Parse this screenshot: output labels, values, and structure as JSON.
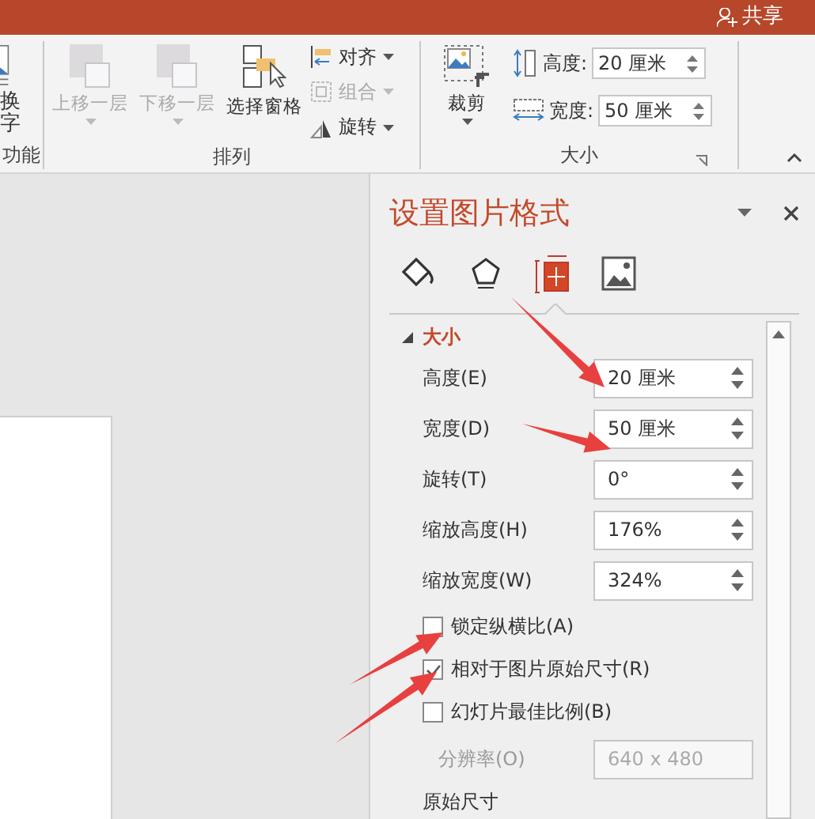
{
  "title_bar": {
    "share": "共享"
  },
  "ribbon": {
    "groups": [
      {
        "label": "功能",
        "items": [
          {
            "kind": "change_picture",
            "lines": [
              "换",
              "字"
            ]
          }
        ]
      },
      {
        "label": "排列",
        "items": [
          {
            "kind": "bring_forward",
            "label": "上移一层",
            "disabled": true
          },
          {
            "kind": "send_backward",
            "label": "下移一层",
            "disabled": true
          },
          {
            "kind": "selection_pane",
            "label": "选择窗格",
            "disabled": false
          },
          {
            "kind": "small_stack",
            "items": [
              {
                "kind": "align",
                "label": "对齐",
                "disabled": false
              },
              {
                "kind": "group",
                "label": "组合",
                "disabled": true
              },
              {
                "kind": "rotate",
                "label": "旋转",
                "disabled": false
              }
            ]
          }
        ]
      },
      {
        "label": "大小",
        "items": [
          {
            "kind": "crop",
            "label": "裁剪",
            "disabled": false
          },
          {
            "kind": "size_fields",
            "items": [
              {
                "kind": "height",
                "label": "高度:",
                "value": "20 厘米"
              },
              {
                "kind": "width",
                "label": "宽度:",
                "value": "50 厘米"
              }
            ]
          }
        ]
      }
    ]
  },
  "pane": {
    "title": "设置图片格式",
    "tabs": [
      {
        "kind": "fill",
        "selected": false
      },
      {
        "kind": "effects",
        "selected": false
      },
      {
        "kind": "size",
        "selected": true
      },
      {
        "kind": "picture",
        "selected": false
      }
    ],
    "section": {
      "title": "大小",
      "expanded": true
    },
    "rows": [
      {
        "kind": "spin",
        "label": "高度(E)",
        "value": "20 厘米"
      },
      {
        "kind": "spin",
        "label": "宽度(D)",
        "value": "50 厘米"
      },
      {
        "kind": "spin",
        "label": "旋转(T)",
        "value": "0°"
      },
      {
        "kind": "spin",
        "label": "缩放高度(H)",
        "value": "176%"
      },
      {
        "kind": "spin",
        "label": "缩放宽度(W)",
        "value": "324%"
      },
      {
        "kind": "check",
        "label": "锁定纵横比(A)",
        "checked": false
      },
      {
        "kind": "check",
        "label": "相对于图片原始尺寸(R)",
        "checked": true
      },
      {
        "kind": "check",
        "label": "幻灯片最佳比例(B)",
        "checked": false
      },
      {
        "kind": "select",
        "label": "分辨率(O)",
        "value": "640 x 480",
        "disabled": true
      },
      {
        "kind": "heading",
        "label": "原始尺寸"
      }
    ]
  }
}
